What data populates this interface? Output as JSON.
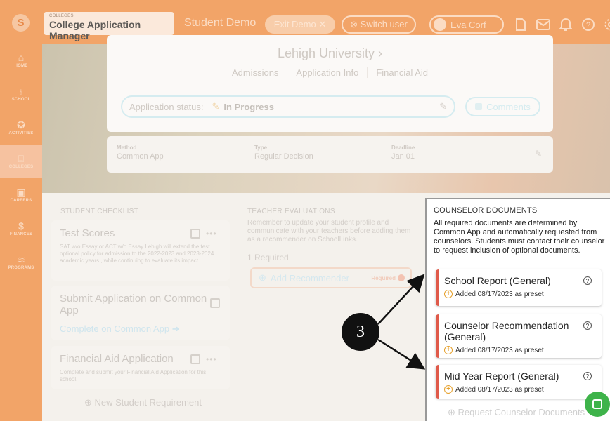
{
  "topbar": {
    "logo_glyph": "S",
    "crumb_small": "COLLEGES",
    "crumb_title": "College Application Manager",
    "demo_label": "Student Demo",
    "exit_demo": "Exit Demo ✕",
    "switch_user": "⊗ Switch user",
    "user_name": "Eva Corf",
    "icons": [
      "document-icon",
      "mail-icon",
      "bell-icon",
      "help-icon",
      "gear-icon"
    ],
    "bg_color": "#f2a468"
  },
  "sidebar": {
    "items": [
      {
        "label": "HOME",
        "icon": "⌂"
      },
      {
        "label": "SCHOOL",
        "icon": "♁"
      },
      {
        "label": "ACTIVITIES",
        "icon": "✪"
      },
      {
        "label": "COLLEGES",
        "icon": "⌸"
      },
      {
        "label": "CAREERS",
        "icon": "▣"
      },
      {
        "label": "FINANCES",
        "icon": "$"
      },
      {
        "label": "PROGRAMS",
        "icon": "≋"
      }
    ],
    "active": "COLLEGES"
  },
  "hero": {
    "university": "Lehigh University ›",
    "tabs": [
      "Admissions",
      "Application Info",
      "Financial Aid"
    ],
    "status_label": "Application status:",
    "status_value": "In Progress",
    "comments": "Comments",
    "method": {
      "label": "Method",
      "value": "Common App"
    },
    "type": {
      "label": "Type",
      "value": "Regular Decision"
    },
    "deadline": {
      "label": "Deadline",
      "value": "Jan 01"
    }
  },
  "checklist": {
    "header": "STUDENT CHECKLIST",
    "items": [
      {
        "title": "Test Scores",
        "desc": "SAT w/o Essay or ACT w/o Essay Lehigh will extend the test optional policy for admission to the 2022-2023 and 2023-2024 academic years , while continuing to evaluate its impact."
      },
      {
        "title": "Submit Application on Common App",
        "link": "Complete on Common App ➔"
      },
      {
        "title": "Financial Aid Application",
        "desc": "Complete and submit your Financial Aid Application for this school."
      }
    ],
    "new_req": "⊕ New Student Requirement"
  },
  "teachers": {
    "header": "TEACHER EVALUATIONS",
    "desc": "Remember to update your student profile and communicate with your teachers before adding them as a recommender on SchoolLinks.",
    "required": "1 Required",
    "add": "Add Recommender",
    "req_tag": "Required"
  },
  "counselor": {
    "header": "COUNSELOR DOCUMENTS",
    "info": "All required documents are determined by Common App and automatically requested from counselors. Students must contact their counselor to request inclusion of optional documents.",
    "docs": [
      {
        "title": "School Report (General)",
        "sub": "Added 08/17/2023 as preset"
      },
      {
        "title": "Counselor Recommendation (General)",
        "sub": "Added 08/17/2023 as preset"
      },
      {
        "title": "Mid Year Report (General)",
        "sub": "Added 08/17/2023 as preset"
      }
    ],
    "request": "⊕ Request Counselor Documents",
    "accent": "#e05a4a"
  },
  "annotation": {
    "number": "3"
  }
}
